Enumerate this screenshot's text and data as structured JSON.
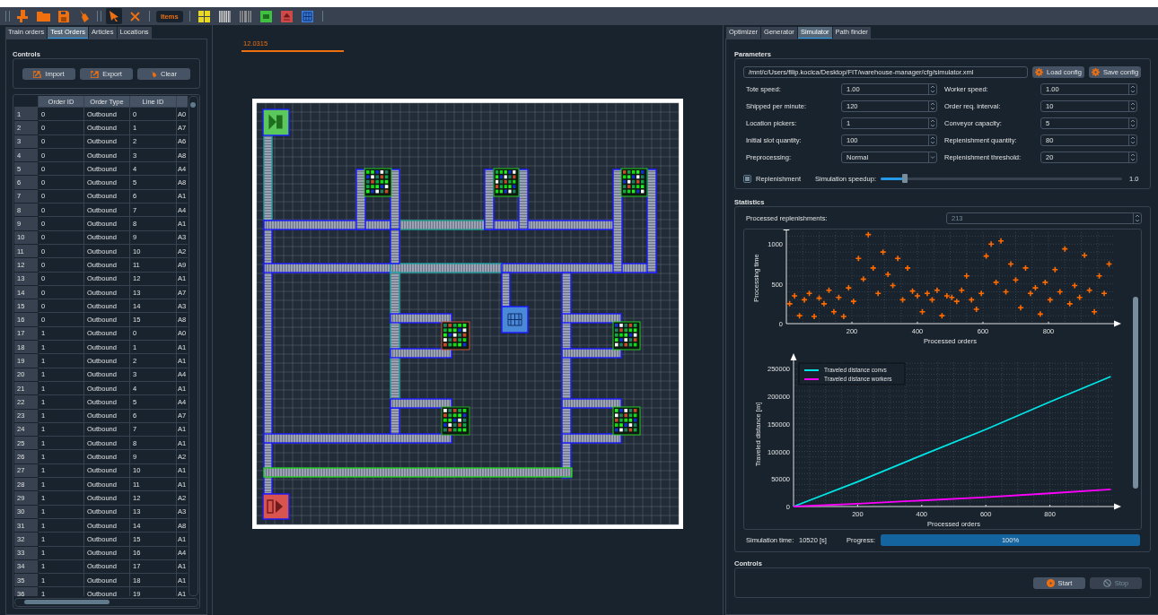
{
  "toolbar": {
    "file_tools": [
      {
        "kind": "new"
      },
      {
        "kind": "open"
      },
      {
        "kind": "save"
      },
      {
        "kind": "clear"
      }
    ],
    "mode_tools": [
      {
        "kind": "select",
        "selected": true
      },
      {
        "kind": "delete",
        "selected": false
      }
    ],
    "items_button": "Items",
    "item_tools": [
      {
        "kind": "rack"
      },
      {
        "kind": "conveyor"
      },
      {
        "kind": "conveyor-dark"
      },
      {
        "kind": "picker"
      },
      {
        "kind": "exit"
      },
      {
        "kind": "storage"
      }
    ]
  },
  "left_panel": {
    "tabs": [
      {
        "label": "Train orders",
        "selected": false
      },
      {
        "label": "Test Orders",
        "selected": true
      },
      {
        "label": "Articles",
        "selected": false
      },
      {
        "label": "Locations",
        "selected": false
      }
    ],
    "controls": {
      "title": "Controls",
      "buttons": [
        {
          "kind": "import",
          "label": "Import"
        },
        {
          "kind": "export",
          "label": "Export"
        },
        {
          "kind": "clear",
          "label": "Clear"
        }
      ]
    },
    "table": {
      "columns": [
        "Order ID",
        "Order Type",
        "Line ID"
      ],
      "rows": [
        {
          "number": "1",
          "cells": [
            "0",
            "Outbound",
            "0",
            "A0"
          ]
        },
        {
          "number": "2",
          "cells": [
            "0",
            "Outbound",
            "1",
            "A7"
          ]
        },
        {
          "number": "3",
          "cells": [
            "0",
            "Outbound",
            "2",
            "A6"
          ]
        },
        {
          "number": "4",
          "cells": [
            "0",
            "Outbound",
            "3",
            "A8"
          ]
        },
        {
          "number": "5",
          "cells": [
            "0",
            "Outbound",
            "4",
            "A4"
          ]
        },
        {
          "number": "6",
          "cells": [
            "0",
            "Outbound",
            "5",
            "A8"
          ]
        },
        {
          "number": "7",
          "cells": [
            "0",
            "Outbound",
            "6",
            "A1"
          ]
        },
        {
          "number": "8",
          "cells": [
            "0",
            "Outbound",
            "7",
            "A4"
          ]
        },
        {
          "number": "9",
          "cells": [
            "0",
            "Outbound",
            "8",
            "A1"
          ]
        },
        {
          "number": "10",
          "cells": [
            "0",
            "Outbound",
            "9",
            "A3"
          ]
        },
        {
          "number": "11",
          "cells": [
            "0",
            "Outbound",
            "10",
            "A2"
          ]
        },
        {
          "number": "12",
          "cells": [
            "0",
            "Outbound",
            "11",
            "A9"
          ]
        },
        {
          "number": "13",
          "cells": [
            "0",
            "Outbound",
            "12",
            "A1"
          ]
        },
        {
          "number": "14",
          "cells": [
            "0",
            "Outbound",
            "13",
            "A7"
          ]
        },
        {
          "number": "15",
          "cells": [
            "0",
            "Outbound",
            "14",
            "A3"
          ]
        },
        {
          "number": "16",
          "cells": [
            "0",
            "Outbound",
            "15",
            "A8"
          ]
        },
        {
          "number": "17",
          "cells": [
            "1",
            "Outbound",
            "0",
            "A0"
          ]
        },
        {
          "number": "18",
          "cells": [
            "1",
            "Outbound",
            "1",
            "A1"
          ]
        },
        {
          "number": "19",
          "cells": [
            "1",
            "Outbound",
            "2",
            "A1"
          ]
        },
        {
          "number": "20",
          "cells": [
            "1",
            "Outbound",
            "3",
            "A4"
          ]
        },
        {
          "number": "21",
          "cells": [
            "1",
            "Outbound",
            "4",
            "A1"
          ]
        },
        {
          "number": "22",
          "cells": [
            "1",
            "Outbound",
            "5",
            "A4"
          ]
        },
        {
          "number": "23",
          "cells": [
            "1",
            "Outbound",
            "6",
            "A7"
          ]
        },
        {
          "number": "24",
          "cells": [
            "1",
            "Outbound",
            "7",
            "A1"
          ]
        },
        {
          "number": "25",
          "cells": [
            "1",
            "Outbound",
            "8",
            "A1"
          ]
        },
        {
          "number": "26",
          "cells": [
            "1",
            "Outbound",
            "9",
            "A2"
          ]
        },
        {
          "number": "27",
          "cells": [
            "1",
            "Outbound",
            "10",
            "A1"
          ]
        },
        {
          "number": "28",
          "cells": [
            "1",
            "Outbound",
            "11",
            "A1"
          ]
        },
        {
          "number": "29",
          "cells": [
            "1",
            "Outbound",
            "12",
            "A2"
          ]
        },
        {
          "number": "30",
          "cells": [
            "1",
            "Outbound",
            "13",
            "A3"
          ]
        },
        {
          "number": "31",
          "cells": [
            "1",
            "Outbound",
            "14",
            "A8"
          ]
        },
        {
          "number": "32",
          "cells": [
            "1",
            "Outbound",
            "15",
            "A1"
          ]
        },
        {
          "number": "33",
          "cells": [
            "1",
            "Outbound",
            "16",
            "A4"
          ]
        },
        {
          "number": "34",
          "cells": [
            "1",
            "Outbound",
            "17",
            "A1"
          ]
        },
        {
          "number": "35",
          "cells": [
            "1",
            "Outbound",
            "18",
            "A1"
          ]
        },
        {
          "number": "36",
          "cells": [
            "1",
            "Outbound",
            "19",
            "A1"
          ]
        }
      ]
    }
  },
  "center": {
    "scale_label": "12.0315"
  },
  "right_panel": {
    "tabs": [
      {
        "label": "Optimizer",
        "selected": false
      },
      {
        "label": "Generator",
        "selected": false
      },
      {
        "label": "Simulator",
        "selected": true
      },
      {
        "label": "Path finder",
        "selected": false
      }
    ],
    "parameters": {
      "title": "Parameters",
      "config_path": "/mnt/c/Users/filip.kocica/Desktop/FIT/warehouse-manager/cfg/simulator.xml",
      "load_button": "Load config",
      "save_button": "Save config",
      "fields": [
        {
          "kind": "spin",
          "label": "Tote speed:",
          "value": "1.00"
        },
        {
          "kind": "spin",
          "label": "Worker speed:",
          "value": "1.00"
        },
        {
          "kind": "spin",
          "label": "Shipped per minute:",
          "value": "120"
        },
        {
          "kind": "spin",
          "label": "Order req. interval:",
          "value": "10"
        },
        {
          "kind": "spin",
          "label": "Location pickers:",
          "value": "1"
        },
        {
          "kind": "spin",
          "label": "Conveyor capacity:",
          "value": "5"
        },
        {
          "kind": "spin",
          "label": "Initial slot quantity:",
          "value": "100"
        },
        {
          "kind": "spin",
          "label": "Replenishment quantity:",
          "value": "80"
        },
        {
          "kind": "combo",
          "label": "Preprocessing:",
          "value": "Normal"
        },
        {
          "kind": "spin",
          "label": "Replenishment threshold:",
          "value": "20"
        }
      ],
      "replenishment": {
        "label": "Replenishment",
        "checked": true
      },
      "speedup": {
        "label": "Simulation speedup:",
        "level": 0.1,
        "reading": "1.0"
      }
    },
    "statistics": {
      "title": "Statistics",
      "replenishments": {
        "label": "Processed replenishments:",
        "value": "213",
        "disabled": true
      },
      "scatter": {
        "chart_data": {
          "type": "scatter",
          "grid": true,
          "xlabel": "Processed orders",
          "ylabel": "Processing time",
          "xlim": [
            0,
            1000
          ],
          "ylim": [
            0,
            1150
          ],
          "xticks": [
            200,
            400,
            600,
            800
          ],
          "yticks": [
            0,
            500,
            1000
          ],
          "x": [
            10,
            25,
            40,
            55,
            70,
            85,
            100,
            115,
            130,
            145,
            160,
            175,
            190,
            205,
            220,
            235,
            250,
            265,
            280,
            295,
            310,
            325,
            340,
            355,
            370,
            385,
            400,
            415,
            430,
            445,
            460,
            475,
            490,
            505,
            520,
            535,
            550,
            565,
            580,
            595,
            610,
            625,
            640,
            655,
            670,
            685,
            700,
            715,
            730,
            745,
            760,
            775,
            790,
            805,
            820,
            835,
            850,
            865,
            880,
            895,
            910,
            925,
            940,
            955,
            970,
            985
          ],
          "series": [
            {
              "color": "#ff6a00",
              "values": [
                250,
                350,
                100,
                300,
                380,
                90,
                320,
                250,
                420,
                150,
                330,
                90,
                450,
                280,
                820,
                560,
                1120,
                700,
                380,
                900,
                620,
                480,
                820,
                300,
                700,
                410,
                350,
                150,
                380,
                300,
                420,
                100,
                350,
                330,
                280,
                420,
                600,
                300,
                180,
                380,
                850,
                1000,
                520,
                1040,
                400,
                750,
                550,
                200,
                700,
                380,
                450,
                120,
                520,
                300,
                680,
                400,
                940,
                250,
                480,
                330,
                860,
                420,
                150,
                600,
                380,
                750
              ]
            }
          ]
        }
      },
      "distance": {
        "chart_data": {
          "type": "line",
          "grid": true,
          "legend": "upper left",
          "xlabel": "Processed orders",
          "ylabel": "Traveled distance [m]",
          "xlim": [
            0,
            1000
          ],
          "ylim": [
            0,
            262000
          ],
          "xticks": [
            200,
            400,
            600,
            800
          ],
          "yticks": [
            0,
            50000,
            100000,
            150000,
            200000,
            250000
          ],
          "x": [
            0,
            200,
            400,
            600,
            800,
            990
          ],
          "series": [
            {
              "name": "Traveled distance convs",
              "color": "#00e5e5",
              "values": [
                0,
                45000,
                93000,
                140000,
                190000,
                236000
              ]
            },
            {
              "name": "Traveled distance workers",
              "color": "#ff00ff",
              "values": [
                0,
                5000,
                11000,
                17000,
                24000,
                31000
              ]
            }
          ]
        }
      },
      "simulation_time": {
        "label": "Simulation time:",
        "value": "10520 [s]"
      },
      "progress": {
        "label": "Progress:",
        "level": 1,
        "text": "100%"
      }
    },
    "controls": {
      "title": "Controls",
      "buttons": [
        {
          "kind": "start",
          "label": "Start",
          "disabled": false
        },
        {
          "kind": "stop",
          "label": "Stop",
          "disabled": true
        }
      ]
    }
  }
}
